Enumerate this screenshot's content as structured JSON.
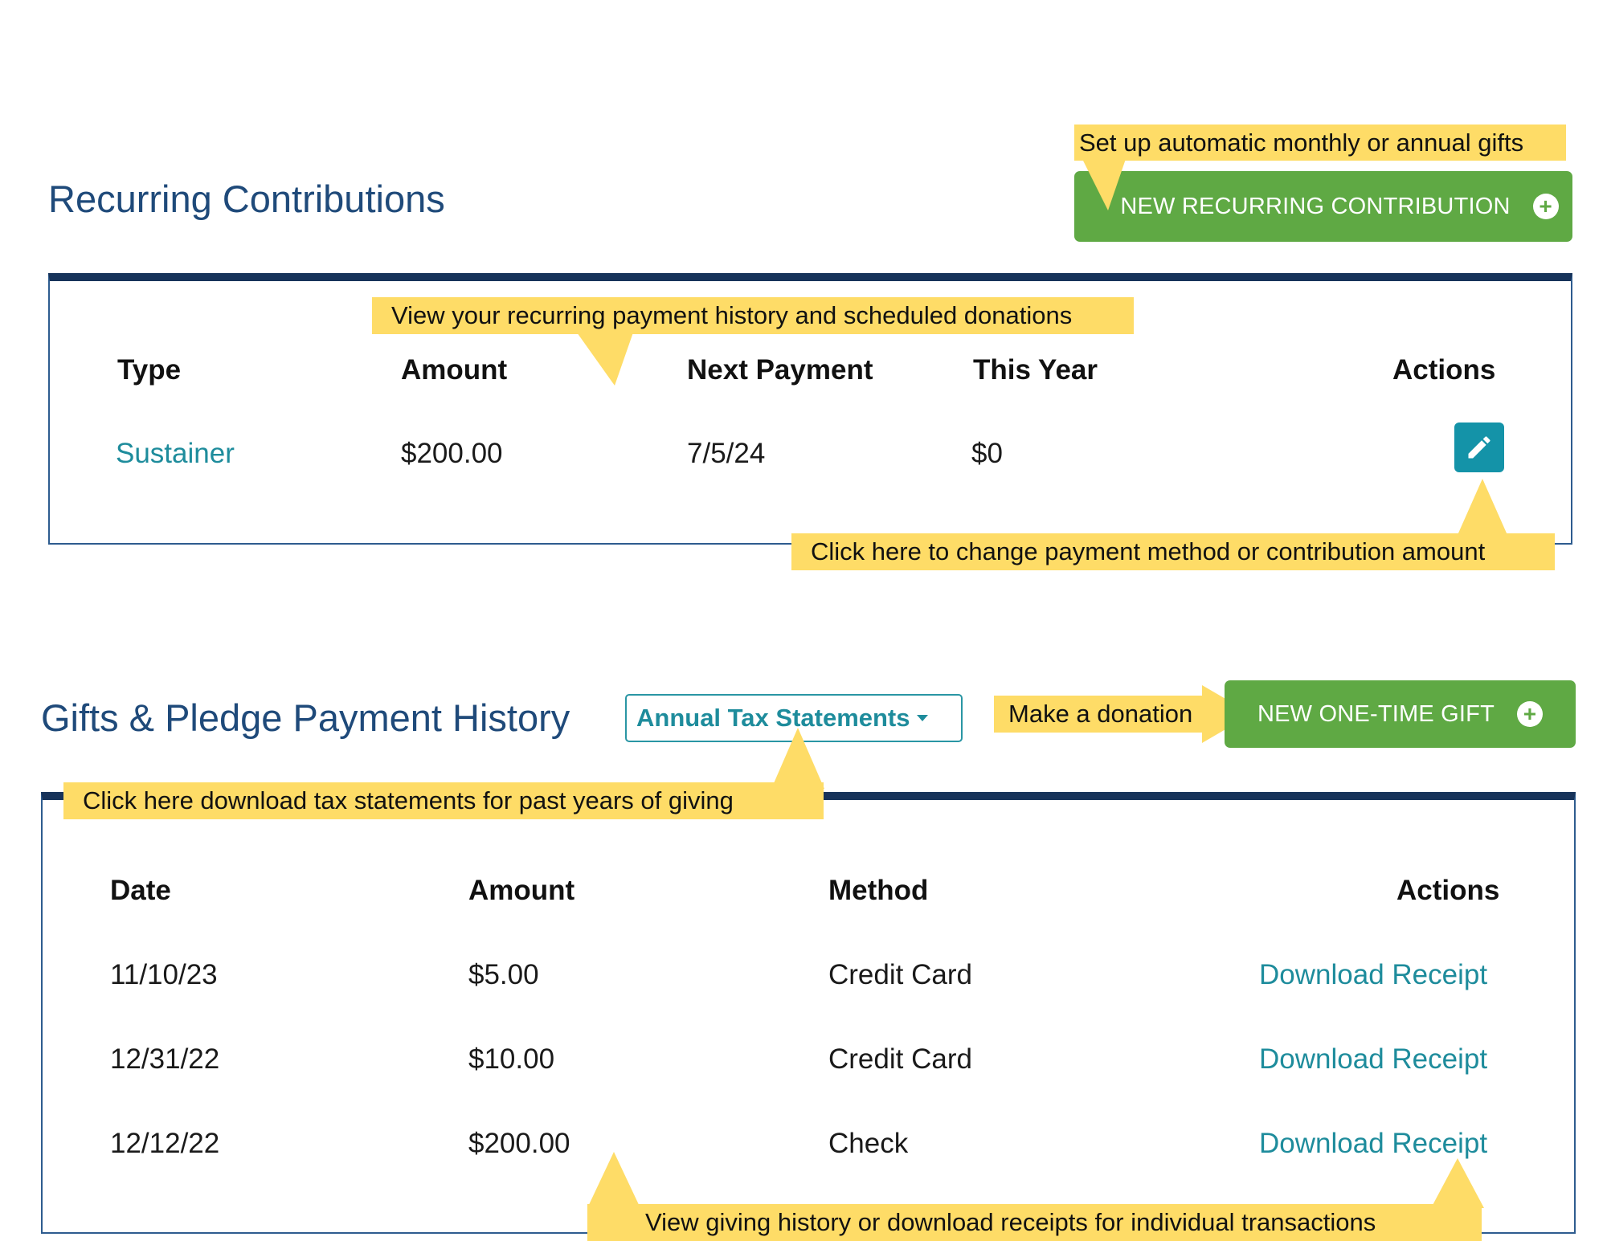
{
  "recurring": {
    "title": "Recurring Contributions",
    "new_button_label": "NEW RECURRING CONTRIBUTION",
    "columns": [
      "Type",
      "Amount",
      "Next Payment",
      "This Year",
      "Actions"
    ],
    "rows": [
      {
        "type": "Sustainer",
        "amount": "$200.00",
        "next_payment": "7/5/24",
        "this_year": "$0"
      }
    ]
  },
  "gifts": {
    "title": "Gifts & Pledge Payment History",
    "tax_dropdown_label": "Annual Tax Statements",
    "new_button_label": "NEW ONE-TIME GIFT",
    "columns": [
      "Date",
      "Amount",
      "Method",
      "Actions"
    ],
    "rows": [
      {
        "date": "11/10/23",
        "amount": "$5.00",
        "method": "Credit Card",
        "action": "Download Receipt"
      },
      {
        "date": "12/31/22",
        "amount": "$10.00",
        "method": "Credit Card",
        "action": "Download Receipt"
      },
      {
        "date": "12/12/22",
        "amount": "$200.00",
        "method": "Check",
        "action": "Download Receipt"
      }
    ]
  },
  "callouts": {
    "recurring_setup": "Set up automatic monthly or annual gifts",
    "recurring_history": "View your recurring payment history and scheduled donations",
    "edit_payment": "Click here to change payment method or contribution amount",
    "make_donation": "Make a donation",
    "tax_statements": "Click here download tax statements for past years of giving",
    "giving_history": "View giving history or download receipts for individual transactions"
  },
  "icons": {
    "plus": "plus-circle-icon",
    "edit": "pencil-icon",
    "dropdown": "caret-down-icon"
  },
  "colors": {
    "heading": "#1f4a7a",
    "button_green": "#5fa944",
    "link_teal": "#1e8c9c",
    "callout_yellow": "#fedc67",
    "panel_border": "#17335a"
  }
}
